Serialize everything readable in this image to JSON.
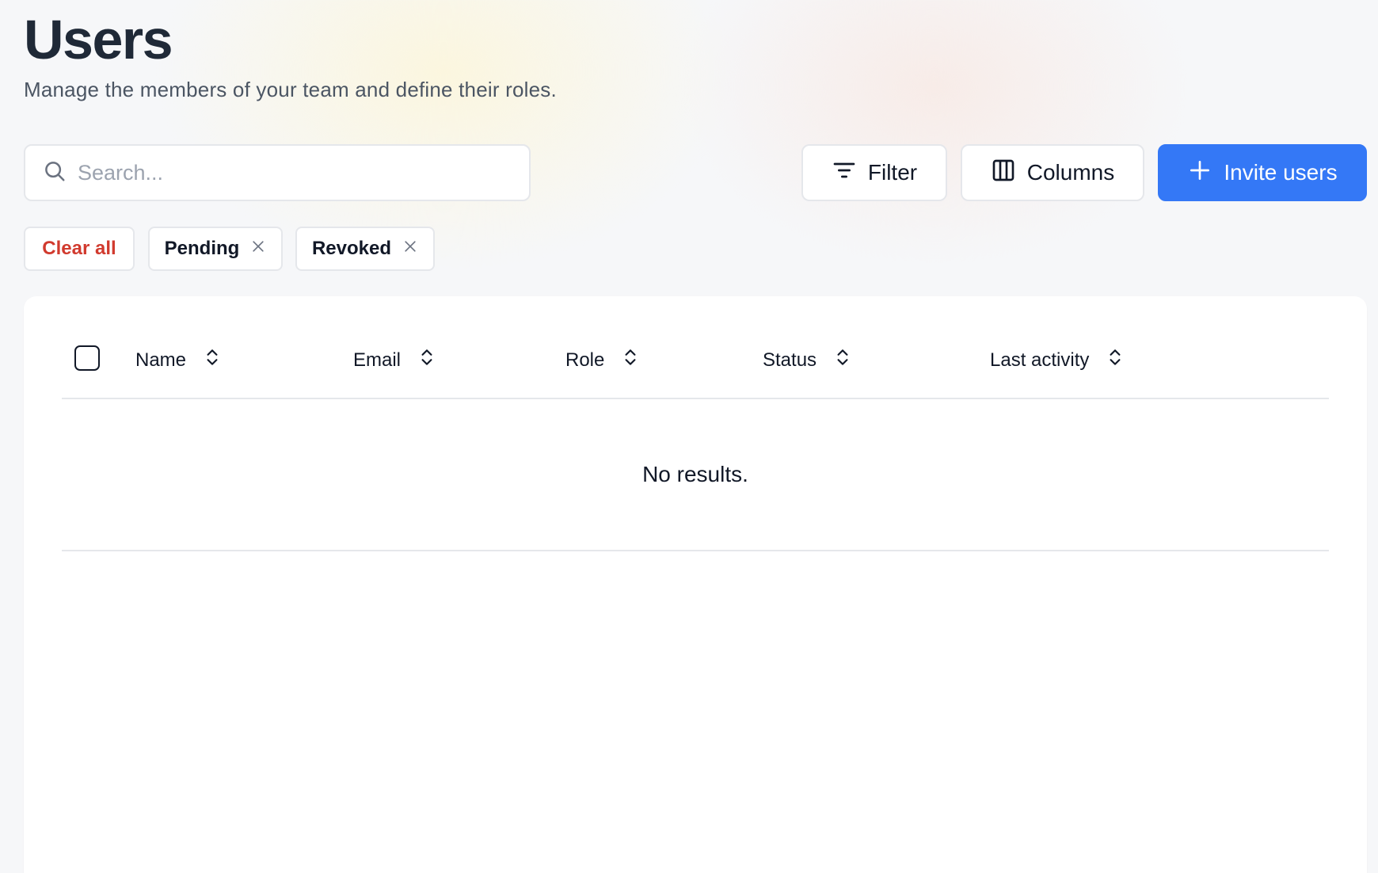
{
  "header": {
    "title": "Users",
    "subtitle": "Manage the members of your team and define their roles."
  },
  "toolbar": {
    "search_placeholder": "Search...",
    "search_value": "",
    "filter_label": "Filter",
    "columns_label": "Columns",
    "invite_label": "Invite users"
  },
  "active_filters": {
    "clear_all_label": "Clear all",
    "chips": [
      "Pending",
      "Revoked"
    ]
  },
  "table": {
    "columns": [
      "Name",
      "Email",
      "Role",
      "Status",
      "Last activity"
    ],
    "select_all_checked": false,
    "rows": [],
    "empty_message": "No results."
  },
  "colors": {
    "accent": "#3478f6",
    "danger": "#d13a2e"
  },
  "icons": {
    "search": "search-icon",
    "filter": "filter-lines-icon",
    "columns": "columns-icon",
    "invite": "plus-icon",
    "chip_remove": "close-icon",
    "sort": "sort-chevrons-icon"
  }
}
